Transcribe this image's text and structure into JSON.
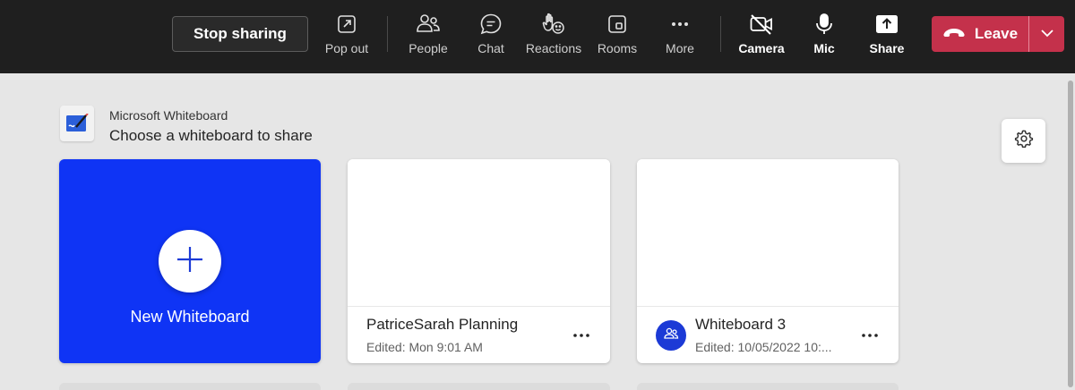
{
  "toolbar": {
    "stop_sharing_label": "Stop sharing",
    "pop_out_label": "Pop out",
    "people_label": "People",
    "chat_label": "Chat",
    "reactions_label": "Reactions",
    "rooms_label": "Rooms",
    "more_label": "More",
    "camera_label": "Camera",
    "mic_label": "Mic",
    "share_label": "Share",
    "leave_label": "Leave",
    "leave_color": "#c4314b"
  },
  "panel": {
    "app_name": "Microsoft Whiteboard",
    "heading": "Choose a whiteboard to share"
  },
  "new_whiteboard": {
    "label": "New Whiteboard",
    "color": "#0f34f5"
  },
  "whiteboards": [
    {
      "title": "PatriceSarah Planning",
      "subtitle": "Edited: Mon 9:01 AM",
      "shared": false
    },
    {
      "title": "Whiteboard 3",
      "subtitle": "Edited: 10/05/2022 10:...",
      "shared": true
    }
  ],
  "icons": {
    "pop_out": "pop-out-icon",
    "people": "people-icon",
    "chat": "chat-icon",
    "reactions": "raise-hand-icon",
    "rooms": "rooms-icon",
    "more": "more-icon",
    "camera": "camera-off-icon",
    "mic": "mic-icon",
    "share": "share-icon",
    "leave": "phone-hangup-icon",
    "settings": "gear-icon"
  }
}
